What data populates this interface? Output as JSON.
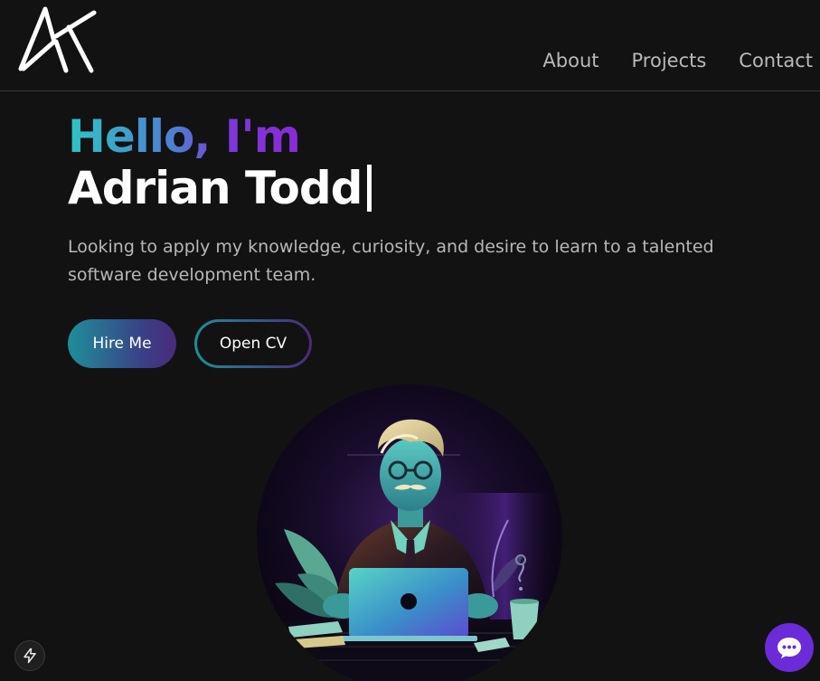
{
  "nav": {
    "logo_alt": "AT",
    "links": [
      "About",
      "Projects",
      "Contact"
    ]
  },
  "hero": {
    "greeting": "Hello, I'm",
    "name": "Adrian Todd",
    "tagline": "Looking to apply my knowledge, curiosity, and desire to learn to a talented software development team."
  },
  "buttons": {
    "hire": "Hire Me",
    "cv": "Open CV"
  },
  "icons": {
    "bolt": "bolt-icon",
    "chat": "chat-icon"
  },
  "colors": {
    "background": "#121212",
    "accent_teal": "#2ec4c4",
    "accent_purple": "#7b38d8",
    "chat_button": "#6c2bd9"
  }
}
